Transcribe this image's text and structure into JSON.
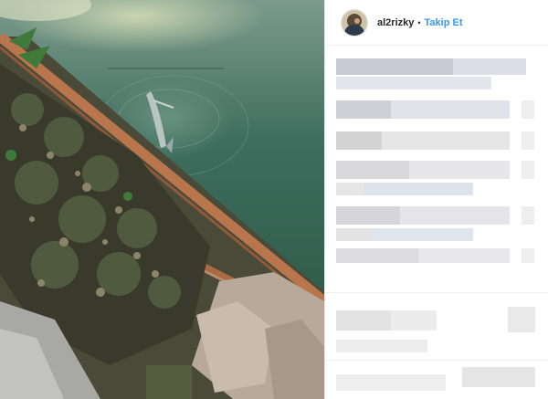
{
  "post": {
    "username": "al2rizky",
    "separator": "•",
    "follow_label": "Takip Et"
  },
  "icons": {
    "avatar": "profile-photo",
    "media": "video-frame-fish-in-canal"
  },
  "colors": {
    "link": "#3897f0",
    "text": "#262626",
    "pixelated": "#d8d8dc"
  }
}
